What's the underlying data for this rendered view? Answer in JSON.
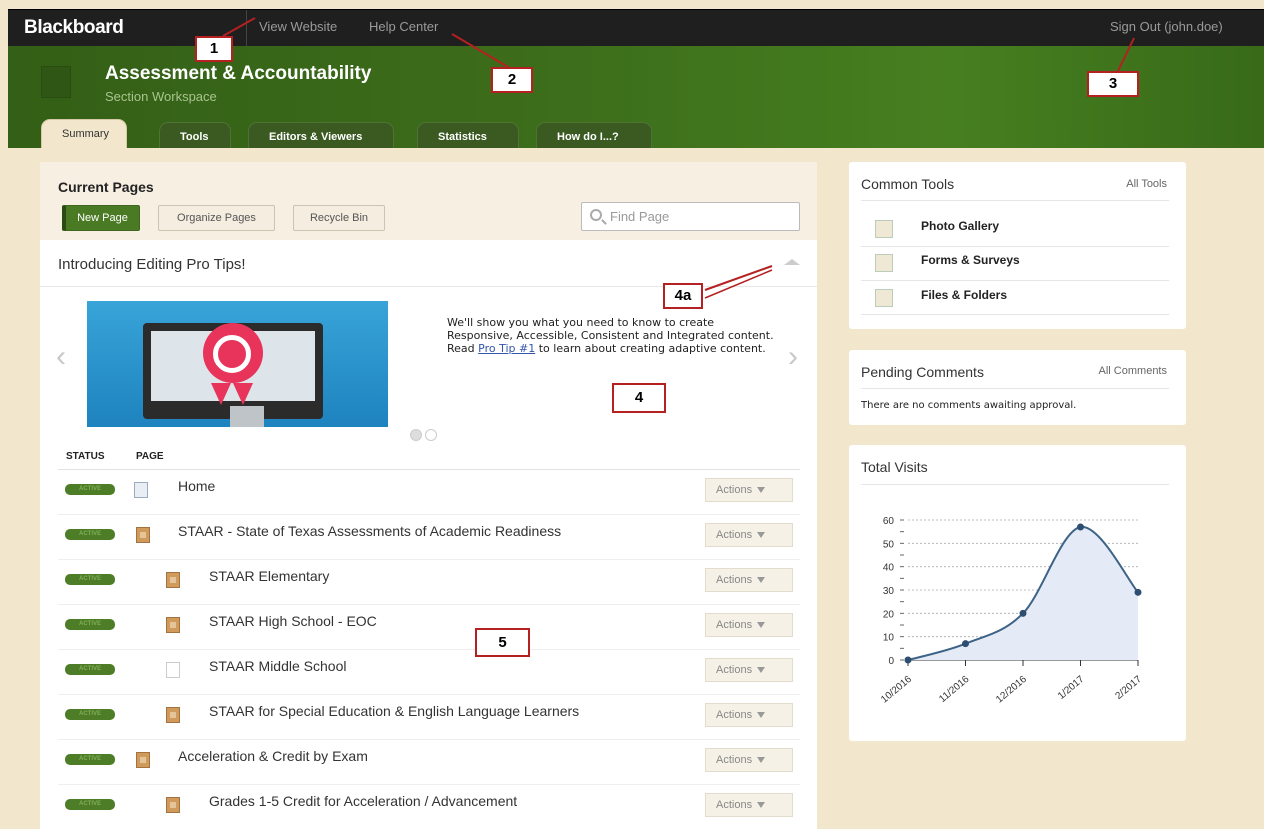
{
  "topbar": {
    "logo": "Blackboard",
    "view_website": "View Website",
    "help_center": "Help Center",
    "sign_out": "Sign Out (john.doe)"
  },
  "header": {
    "title": "Assessment & Accountability",
    "subtitle": "Section Workspace"
  },
  "tabs": [
    {
      "label": "Summary"
    },
    {
      "label": "Tools"
    },
    {
      "label": "Editors & Viewers"
    },
    {
      "label": "Statistics"
    },
    {
      "label": "How do I...?"
    }
  ],
  "callouts": {
    "c1": "1",
    "c2": "2",
    "c3": "3",
    "c4a": "4a",
    "c4": "4",
    "c5": "5"
  },
  "current_pages": {
    "title": "Current Pages",
    "new_page": "New Page",
    "organize": "Organize Pages",
    "recycle": "Recycle Bin",
    "search_placeholder": "Find Page",
    "pro_tips_title": "Introducing Editing Pro Tips!",
    "promo_text_before": "We'll show you what you need to know to create Responsive, Accessible, Consistent and Integrated content. Read ",
    "promo_link": "Pro Tip #1",
    "promo_text_after": " to learn about creating adaptive content.",
    "col_status": "STATUS",
    "col_page": "PAGE",
    "rows": [
      {
        "status": "ACTIVE",
        "name": "Home",
        "actions": "Actions"
      },
      {
        "status": "ACTIVE",
        "name": "STAAR - State of Texas Assessments of Academic Readiness",
        "actions": "Actions"
      },
      {
        "status": "ACTIVE",
        "name": "STAAR Elementary",
        "actions": "Actions"
      },
      {
        "status": "ACTIVE",
        "name": "STAAR High School - EOC",
        "actions": "Actions"
      },
      {
        "status": "ACTIVE",
        "name": "STAAR Middle School",
        "actions": "Actions"
      },
      {
        "status": "ACTIVE",
        "name": "STAAR for Special Education & English Language Learners",
        "actions": "Actions"
      },
      {
        "status": "ACTIVE",
        "name": "Acceleration & Credit by Exam",
        "actions": "Actions"
      },
      {
        "status": "ACTIVE",
        "name": "Grades 1-5 Credit for Acceleration / Advancement",
        "actions": "Actions"
      }
    ]
  },
  "common_tools": {
    "title": "Common Tools",
    "all_link": "All Tools",
    "items": [
      {
        "label": "Photo Gallery"
      },
      {
        "label": "Forms & Surveys"
      },
      {
        "label": "Files & Folders"
      }
    ]
  },
  "pending_comments": {
    "title": "Pending Comments",
    "all_link": "All Comments",
    "message": "There are no comments awaiting approval."
  },
  "total_visits": {
    "title": "Total Visits"
  },
  "chart_data": {
    "type": "area",
    "title": "Total Visits",
    "categories": [
      "10/2016",
      "11/2016",
      "12/2016",
      "1/2017",
      "2/2017"
    ],
    "values": [
      0,
      7,
      20,
      57,
      29
    ],
    "ylim": [
      0,
      60
    ],
    "yticks": [
      0,
      10,
      20,
      30,
      40,
      50,
      60
    ],
    "grid": true,
    "colors": {
      "line": "#3d6386",
      "fill": "#e4eaf6",
      "point": "#2c4e70"
    }
  }
}
